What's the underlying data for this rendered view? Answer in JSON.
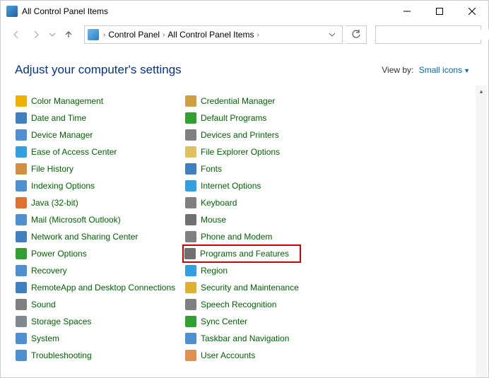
{
  "title": "All Control Panel Items",
  "breadcrumb": {
    "seg1": "Control Panel",
    "seg2": "All Control Panel Items"
  },
  "heading": "Adjust your computer's settings",
  "viewby_label": "View by:",
  "viewby_value": "Small icons",
  "search_placeholder": "",
  "items_col1": [
    {
      "label": "Color Management",
      "c": "#f0b000"
    },
    {
      "label": "Date and Time",
      "c": "#4080c0"
    },
    {
      "label": "Device Manager",
      "c": "#5090d0"
    },
    {
      "label": "Ease of Access Center",
      "c": "#30a0e0"
    },
    {
      "label": "File History",
      "c": "#d09040"
    },
    {
      "label": "Indexing Options",
      "c": "#5090d0"
    },
    {
      "label": "Java (32-bit)",
      "c": "#e07030"
    },
    {
      "label": "Mail (Microsoft Outlook)",
      "c": "#5090d0"
    },
    {
      "label": "Network and Sharing Center",
      "c": "#4080c0"
    },
    {
      "label": "Power Options",
      "c": "#30a030"
    },
    {
      "label": "Recovery",
      "c": "#5090d0"
    },
    {
      "label": "RemoteApp and Desktop Connections",
      "c": "#4080c0"
    },
    {
      "label": "Sound",
      "c": "#808080"
    },
    {
      "label": "Storage Spaces",
      "c": "#808890"
    },
    {
      "label": "System",
      "c": "#5090d0"
    },
    {
      "label": "Troubleshooting",
      "c": "#5090d0"
    }
  ],
  "items_col2": [
    {
      "label": "Credential Manager",
      "c": "#d0a040"
    },
    {
      "label": "Default Programs",
      "c": "#30a030"
    },
    {
      "label": "Devices and Printers",
      "c": "#808080"
    },
    {
      "label": "File Explorer Options",
      "c": "#e0c060"
    },
    {
      "label": "Fonts",
      "c": "#4080c0"
    },
    {
      "label": "Internet Options",
      "c": "#30a0e0"
    },
    {
      "label": "Keyboard",
      "c": "#808080"
    },
    {
      "label": "Mouse",
      "c": "#707070"
    },
    {
      "label": "Phone and Modem",
      "c": "#808080"
    },
    {
      "label": "Programs and Features",
      "c": "#707070",
      "highlight": true
    },
    {
      "label": "Region",
      "c": "#30a0e0"
    },
    {
      "label": "Security and Maintenance",
      "c": "#e0b030"
    },
    {
      "label": "Speech Recognition",
      "c": "#808080"
    },
    {
      "label": "Sync Center",
      "c": "#30a030"
    },
    {
      "label": "Taskbar and Navigation",
      "c": "#5090d0"
    },
    {
      "label": "User Accounts",
      "c": "#e09050"
    }
  ]
}
